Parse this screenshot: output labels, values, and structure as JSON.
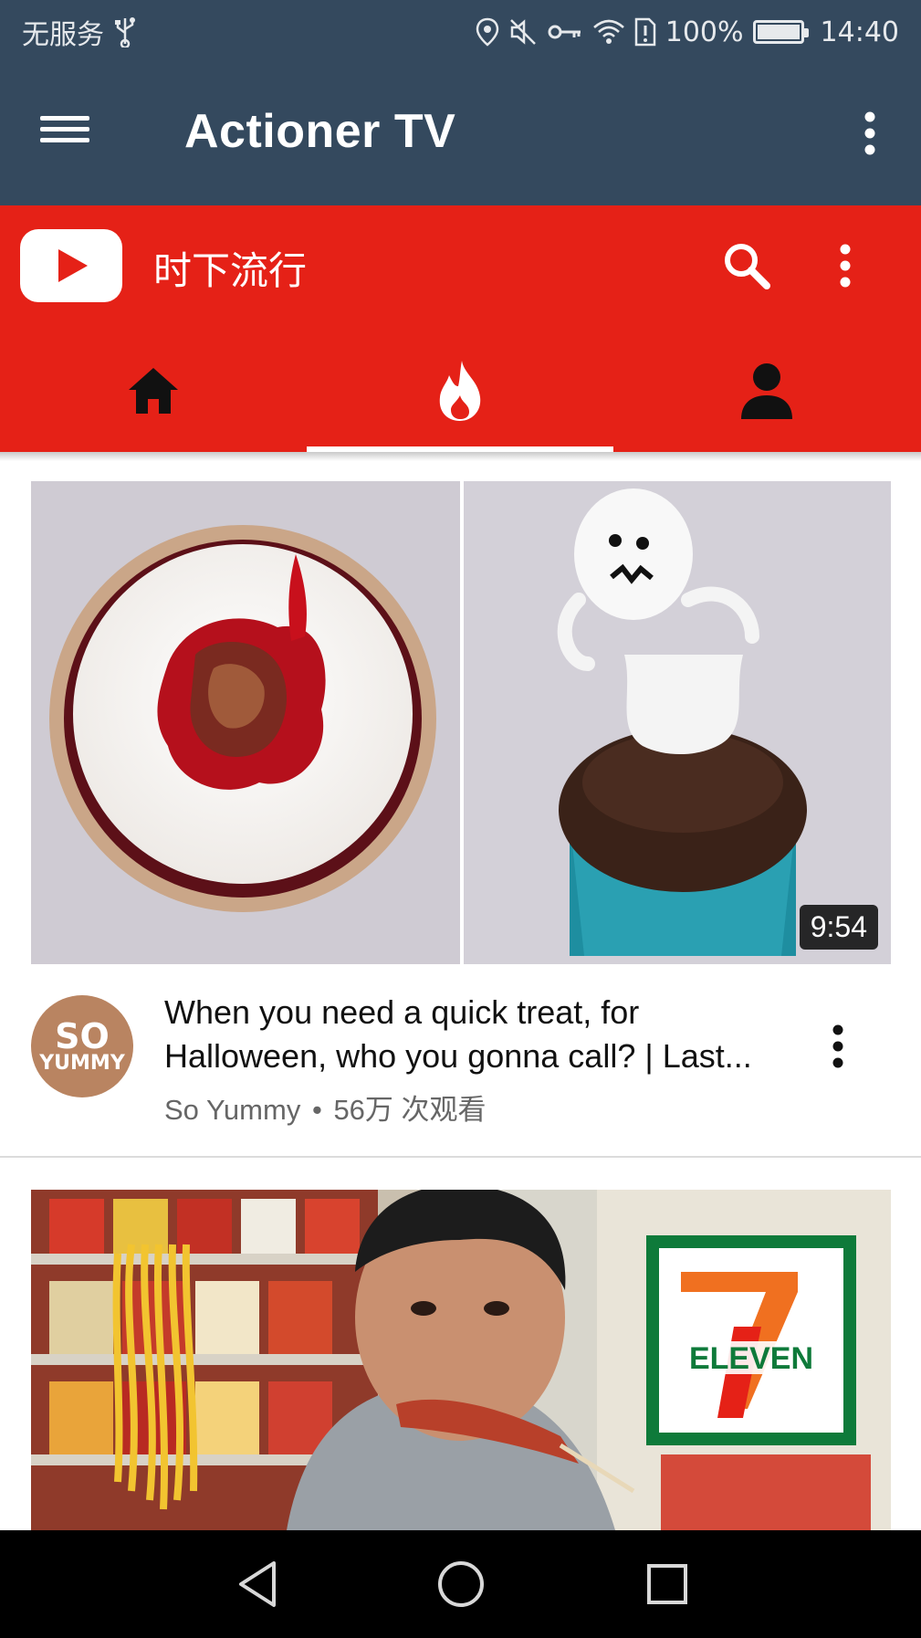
{
  "status_bar": {
    "carrier": "无服务",
    "battery": "100%",
    "battery_level": 1.0,
    "time": "14:40"
  },
  "app_bar": {
    "title": "Actioner TV"
  },
  "youtube": {
    "section_title": "时下流行",
    "tabs": [
      {
        "name": "home",
        "icon": "home-icon",
        "selected": false
      },
      {
        "name": "trending",
        "icon": "fire-icon",
        "selected": true
      },
      {
        "name": "account",
        "icon": "person-icon",
        "selected": false
      }
    ]
  },
  "videos": [
    {
      "title_line1": "When you need a quick treat, for",
      "title_line2": "Halloween, who you gonna call? | Last...",
      "channel": "So Yummy",
      "separator": "•",
      "views": "56万 次观看",
      "duration": "9:54",
      "avatar_text_1": "SO",
      "avatar_text_2": "YUMMY"
    },
    {
      "thumbnail_text": "ELEVEN"
    }
  ],
  "colors": {
    "app_bar": "#34495e",
    "youtube_red": "#e52117"
  }
}
